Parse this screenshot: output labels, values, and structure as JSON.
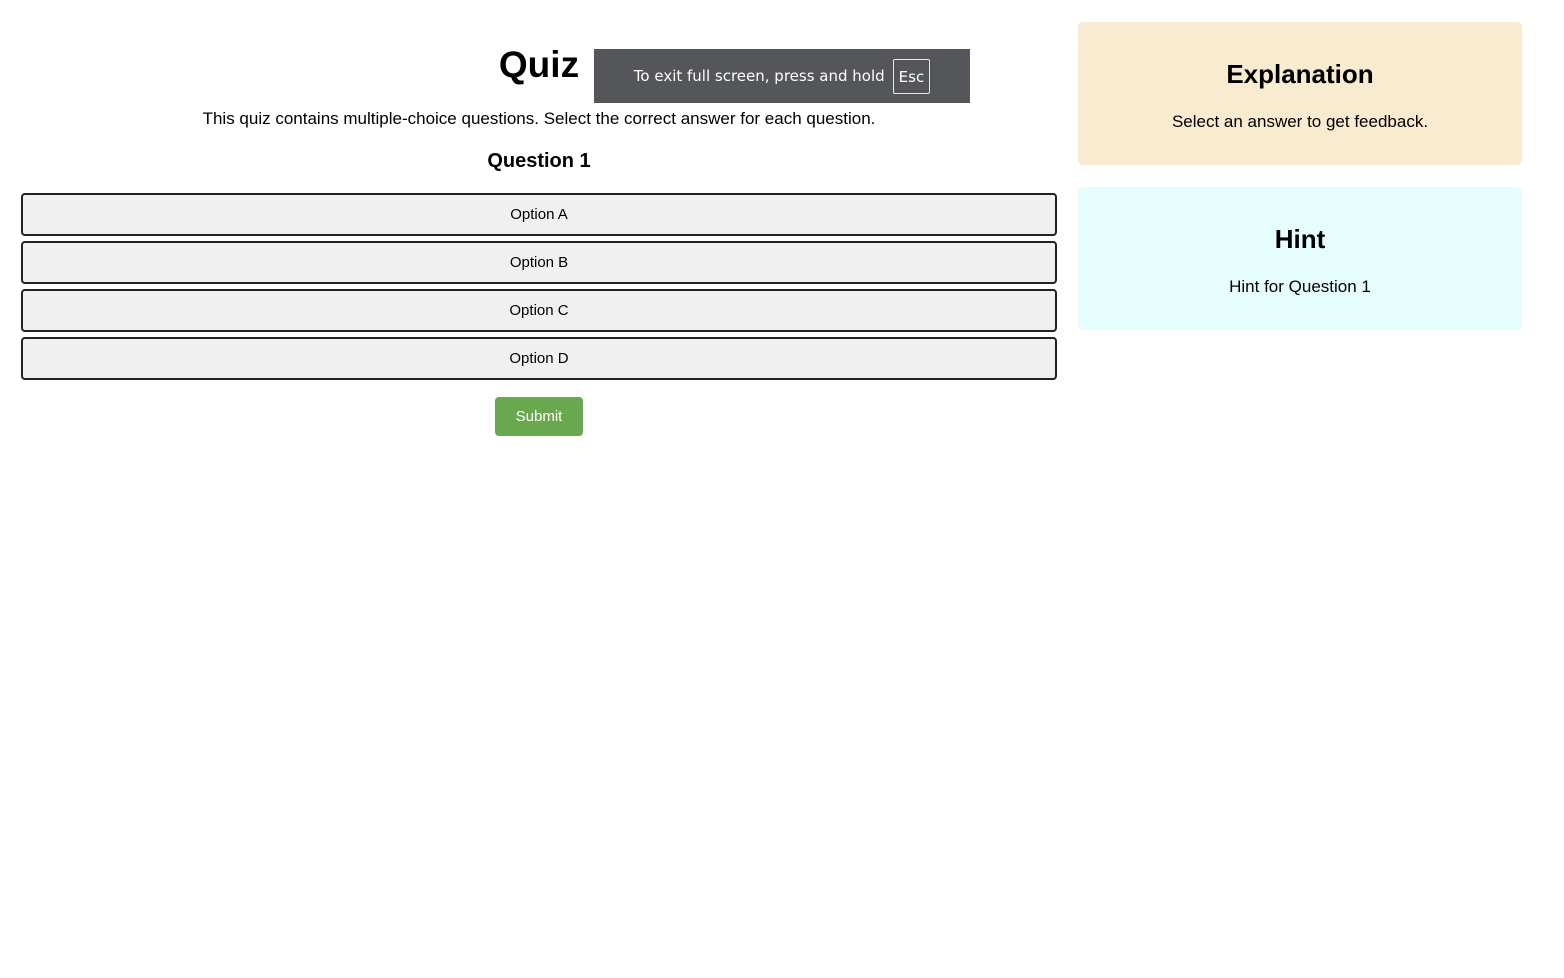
{
  "quiz": {
    "title": "Quiz",
    "intro": "This quiz contains multiple-choice questions. Select the correct answer for each question.",
    "question_title": "Question 1",
    "options": [
      {
        "label": "Option A"
      },
      {
        "label": "Option B"
      },
      {
        "label": "Option C"
      },
      {
        "label": "Option D"
      }
    ],
    "submit_label": "Submit"
  },
  "explanation": {
    "title": "Explanation",
    "text": "Select an answer to get feedback."
  },
  "hint": {
    "title": "Hint",
    "text": "Hint for Question 1"
  },
  "fullscreen_notice": {
    "text": "To exit full screen, press and hold",
    "key": "Esc"
  },
  "colors": {
    "submit": "#6aa84f",
    "explanation_bg": "#f9ebd0",
    "hint_bg": "#e6fdfd",
    "option_bg": "#f0f0f0",
    "toast_bg": "#55565a"
  }
}
